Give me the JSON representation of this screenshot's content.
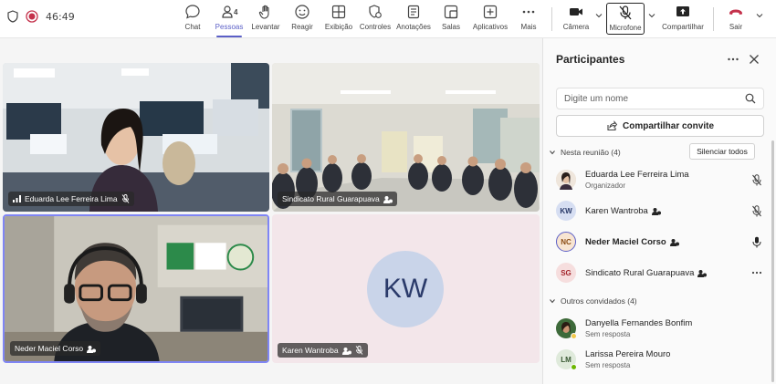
{
  "meeting": {
    "timer": "46:49"
  },
  "toolbar": {
    "chat": "Chat",
    "people": "Pessoas",
    "people_count": "4",
    "raise": "Levantar",
    "react": "Reagir",
    "view": "Exibição",
    "controls": "Controles",
    "notes": "Anotações",
    "rooms": "Salas",
    "apps": "Aplicativos",
    "more": "Mais",
    "camera": "Câmera",
    "mic": "Microfone",
    "share": "Compartilhar",
    "leave": "Sair"
  },
  "tiles": [
    {
      "name": "Eduarda Lee Ferreira Lima"
    },
    {
      "name": "Sindicato Rural Guarapuava"
    },
    {
      "name": "Neder Maciel Corso"
    },
    {
      "name": "Karen Wantroba",
      "initials": "KW"
    }
  ],
  "panel": {
    "title": "Participantes",
    "search_placeholder": "Digite um nome",
    "share_invite": "Compartilhar convite",
    "in_meeting": "Nesta reunião (4)",
    "mute_all": "Silenciar todos",
    "others": "Outros convidados (4)",
    "participants": [
      {
        "name": "Eduarda Lee Ferreira Lima",
        "sub": "Organizador"
      },
      {
        "name": "Karen Wantroba",
        "initials": "KW"
      },
      {
        "name": "Neder Maciel Corso",
        "initials": "NC"
      },
      {
        "name": "Sindicato Rural Guarapuava",
        "initials": "SG"
      }
    ],
    "guests": [
      {
        "name": "Danyella Fernandes Bonfim",
        "sub": "Sem resposta"
      },
      {
        "name": "Larissa Pereira Mouro",
        "initials": "LM",
        "sub": "Sem resposta"
      }
    ]
  },
  "colors": {
    "accent": "#5b5fc7",
    "leave": "#c4314b",
    "kw_tile": "#f3e6ea"
  }
}
